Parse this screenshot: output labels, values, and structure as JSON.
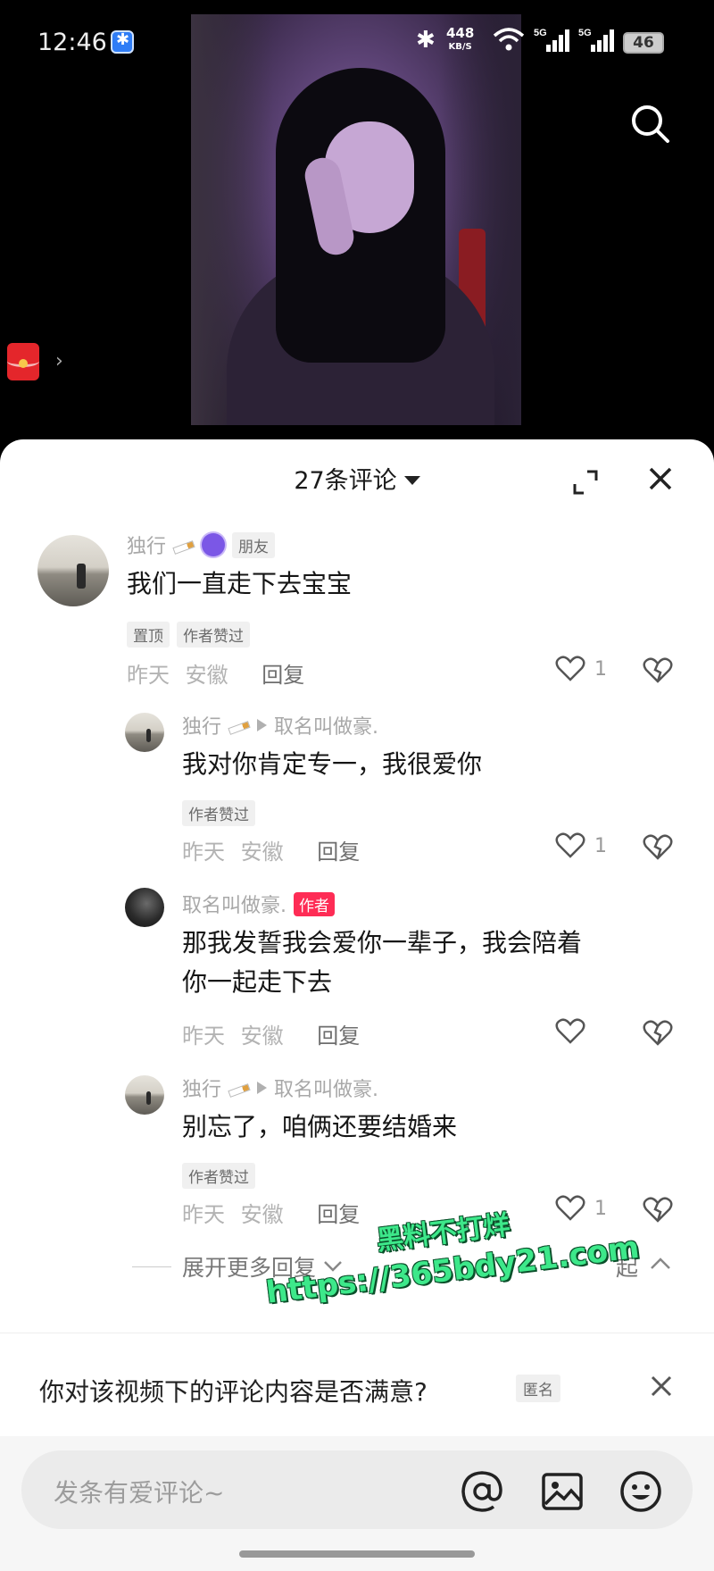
{
  "status_bar": {
    "time": "12:46",
    "net_speed": "448",
    "net_unit": "KB/S",
    "sim1": "5G",
    "sim2": "5G",
    "battery": "46"
  },
  "comments_panel": {
    "title": "27条评论",
    "comments": [
      {
        "user": "独行",
        "user_badge": "朋友",
        "text": "我们一直走下去宝宝",
        "tags": [
          "置顶",
          "作者赞过"
        ],
        "time": "昨天",
        "location": "安徽",
        "reply_label": "回复",
        "likes": "1"
      },
      {
        "user": "独行",
        "reply_to": "取名叫做豪.",
        "text": "我对你肯定专一，我很爱你",
        "tags": [
          "作者赞过"
        ],
        "time": "昨天",
        "location": "安徽",
        "reply_label": "回复",
        "likes": "1"
      },
      {
        "user": "取名叫做豪.",
        "user_badge": "作者",
        "text_line1": "那我发誓我会爱你一辈子，我会陪着",
        "text_line2": "你一起走下去",
        "time": "昨天",
        "location": "安徽",
        "reply_label": "回复",
        "likes": ""
      },
      {
        "user": "独行",
        "reply_to": "取名叫做豪.",
        "text": "别忘了，咱俩还要结婚来",
        "tags": [
          "作者赞过"
        ],
        "time": "昨天",
        "location": "安徽",
        "reply_label": "回复",
        "likes": "1"
      }
    ],
    "expand_more": "展开更多回复",
    "collapse_label": "起"
  },
  "watermark": {
    "line1": "黑料不打烊",
    "line2": "https://365bdy21.com"
  },
  "survey": {
    "question": "你对该视频下的评论内容是否满意?",
    "tag": "匿名"
  },
  "input": {
    "placeholder": "发条有爱评论~"
  },
  "icons": {
    "search": "search-icon",
    "expand": "expand-icon",
    "close": "close-icon",
    "heart": "heart-icon",
    "dislike": "broken-heart-icon",
    "at": "at-icon",
    "image": "image-icon",
    "emoji": "emoji-icon"
  },
  "colors": {
    "author_badge": "#fe2c55",
    "watermark": "#3de88a"
  }
}
